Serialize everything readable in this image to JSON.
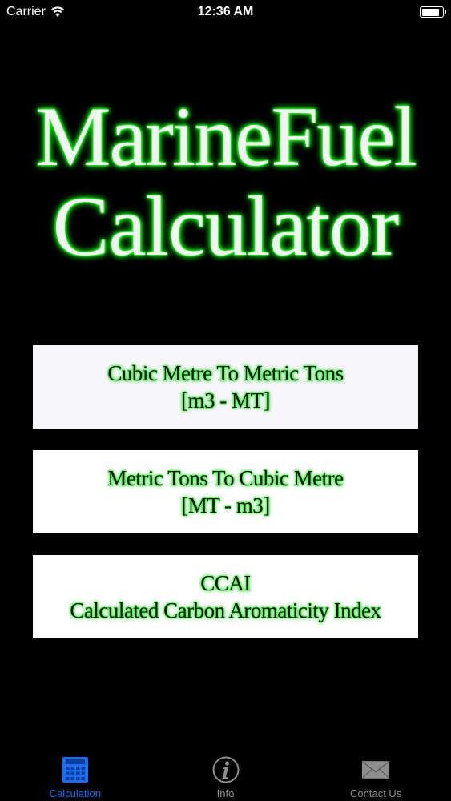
{
  "status_bar": {
    "carrier": "Carrier",
    "time": "12:36 AM",
    "battery_level": 0.85
  },
  "title": {
    "line1": "MarineFuel",
    "line2": "Calculator"
  },
  "menu": [
    {
      "line1": "Cubic Metre To Metric Tons",
      "line2": "[m3 - MT]"
    },
    {
      "line1": "Metric Tons To Cubic Metre",
      "line2": "[MT - m3]"
    },
    {
      "line1": "CCAI",
      "line2": "Calculated Carbon Aromaticity Index"
    }
  ],
  "tabs": [
    {
      "label": "Calculation",
      "icon": "calculator-icon",
      "active": true
    },
    {
      "label": "Info",
      "icon": "info-icon",
      "active": false
    },
    {
      "label": "Contact Us",
      "icon": "envelope-icon",
      "active": false
    }
  ],
  "colors": {
    "background": "#000000",
    "title_glow": "#20ff20",
    "tab_active": "#1a6cf0",
    "tab_inactive": "#8e8e8e"
  }
}
